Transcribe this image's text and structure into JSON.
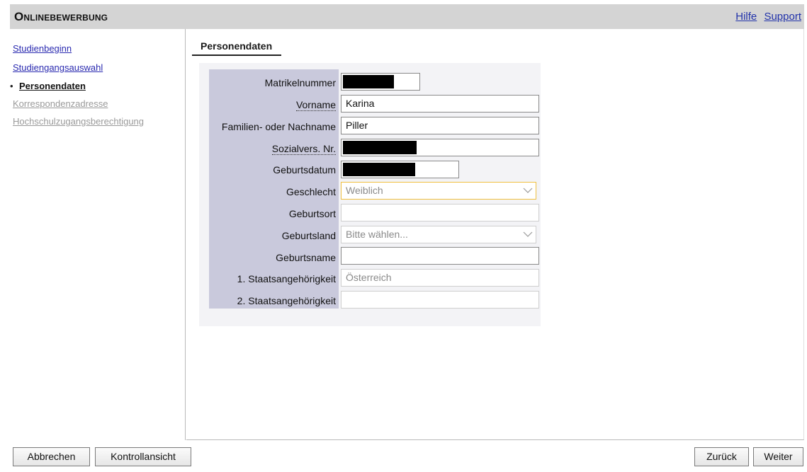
{
  "header": {
    "title": "Onlinebewerbung",
    "links": {
      "help": "Hilfe",
      "support": "Support"
    }
  },
  "sidebar": {
    "current_bullet": "•",
    "items": [
      {
        "label": "Studienbeginn",
        "state": "link"
      },
      {
        "label": "Studiengangsauswahl",
        "state": "link"
      },
      {
        "label": "Personendaten",
        "state": "current"
      },
      {
        "label": "Korrespondenzadresse",
        "state": "disabled"
      },
      {
        "label": "Hochschulzugangsberechtigung",
        "state": "disabled"
      }
    ]
  },
  "main": {
    "section_title": "Personendaten",
    "form": {
      "matrikelnummer": {
        "label": "Matrikelnummer",
        "value": ""
      },
      "vorname": {
        "label": "Vorname",
        "value": "Karina"
      },
      "nachname": {
        "label": "Familien- oder Nachname",
        "value": "Piller"
      },
      "sozialvers": {
        "label": "Sozialvers. Nr.",
        "value": ""
      },
      "geburtsdatum": {
        "label": "Geburtsdatum",
        "value": ""
      },
      "geschlecht": {
        "label": "Geschlecht",
        "value": "Weiblich"
      },
      "geburtsort": {
        "label": "Geburtsort",
        "value": ""
      },
      "geburtsland": {
        "label": "Geburtsland",
        "value": "Bitte wählen..."
      },
      "geburtsname": {
        "label": "Geburtsname",
        "value": ""
      },
      "staat1": {
        "label": "1. Staatsangehörigkeit",
        "value": "Österreich"
      },
      "staat2": {
        "label": "2. Staatsangehörigkeit",
        "value": ""
      }
    }
  },
  "footer": {
    "cancel": "Abbrechen",
    "control_view": "Kontrollansicht",
    "back": "Zurück",
    "next": "Weiter"
  },
  "colors": {
    "header_bg": "#d4d4d4",
    "label_column_bg": "#c9c9dc",
    "link": "#2a2ab0",
    "focus_border": "#f0c040"
  }
}
